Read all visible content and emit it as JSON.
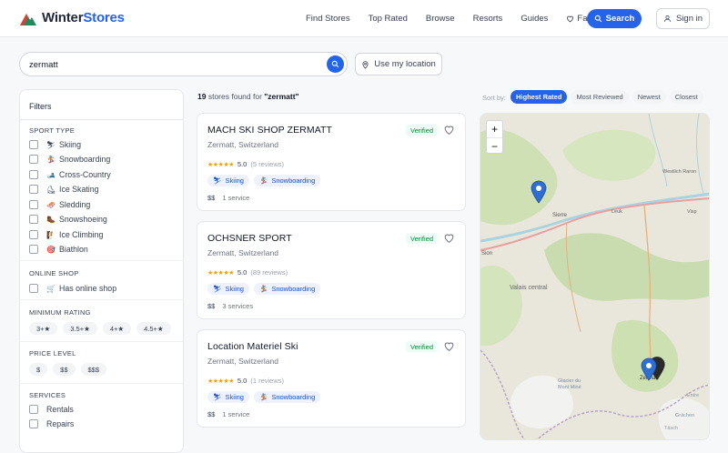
{
  "brand": {
    "name_part1": "Winter",
    "name_part2": "Stores"
  },
  "nav": {
    "items": [
      "Find Stores",
      "Top Rated",
      "Browse",
      "Resorts",
      "Guides",
      "Favorites"
    ],
    "search_label": "Search",
    "signin_label": "Sign in"
  },
  "search": {
    "value": "zermatt",
    "location_label": "Use my location"
  },
  "filters": {
    "title": "Filters",
    "sport_type_title": "SPORT TYPE",
    "sports": [
      {
        "label": "Skiing",
        "icon": "⛷"
      },
      {
        "label": "Snowboarding",
        "icon": "🏂"
      },
      {
        "label": "Cross-Country",
        "icon": "🎿"
      },
      {
        "label": "Ice Skating",
        "icon": "⛸"
      },
      {
        "label": "Sledding",
        "icon": "🛷"
      },
      {
        "label": "Snowshoeing",
        "icon": "🥾"
      },
      {
        "label": "Ice Climbing",
        "icon": "🧗"
      },
      {
        "label": "Biathlon",
        "icon": "🎯"
      }
    ],
    "online_shop_title": "ONLINE SHOP",
    "online_shop_label": "Has online shop",
    "online_shop_icon": "🛒",
    "min_rating_title": "MINIMUM RATING",
    "ratings": [
      "3+★",
      "3.5+★",
      "4+★",
      "4.5+★"
    ],
    "price_title": "PRICE LEVEL",
    "prices": [
      "$",
      "$$",
      "$$$"
    ],
    "services_title": "SERVICES",
    "services": [
      "Rentals",
      "Repairs"
    ]
  },
  "results": {
    "count": "19",
    "text": "stores found for",
    "query": "\"zermatt\"",
    "sort_label": "Sort by:",
    "sort_options": [
      "Highest Rated",
      "Most Reviewed",
      "Newest",
      "Closest"
    ],
    "active_sort": "Highest Rated"
  },
  "stores": [
    {
      "name": "MACH SKI SHOP ZERMATT",
      "location": "Zermatt, Switzerland",
      "verified": "Verified",
      "stars": "★★★★★",
      "rating": "5.0",
      "reviews": "(5 reviews)",
      "tags": [
        "Skiing",
        "Snowboarding"
      ],
      "price": "$$",
      "services": "1 service"
    },
    {
      "name": "OCHSNER SPORT",
      "location": "Zermatt, Switzerland",
      "verified": "Verified",
      "stars": "★★★★★",
      "rating": "5.0",
      "reviews": "(89 reviews)",
      "tags": [
        "Skiing",
        "Snowboarding"
      ],
      "price": "$$",
      "services": "3 services"
    },
    {
      "name": "Location Materiel Ski",
      "location": "Zermatt, Switzerland",
      "verified": "Verified",
      "stars": "★★★★★",
      "rating": "5.0",
      "reviews": "(1 reviews)",
      "tags": [
        "Skiing",
        "Snowboarding"
      ],
      "price": "$$",
      "services": "1 service"
    }
  ],
  "map": {
    "zoom_in": "+",
    "zoom_out": "−",
    "labels": {
      "sierre": "Sierre",
      "sion": "Sion",
      "valais": "Valais central",
      "zermatt": "Zermatt",
      "wesch": "Westlich Raron",
      "glacier": "Glacier du Mont Miné",
      "leuk": "Leuk",
      "visp": "Visp",
      "entre": "Entre",
      "grachen": "Grächen",
      "taesch": "Täsch"
    },
    "colors": {
      "terrain": "#e9e6dc",
      "forest": "#cfe0b4",
      "water": "#aad3df",
      "road": "#e8a0a0",
      "marker": "#2f6fd1"
    }
  }
}
